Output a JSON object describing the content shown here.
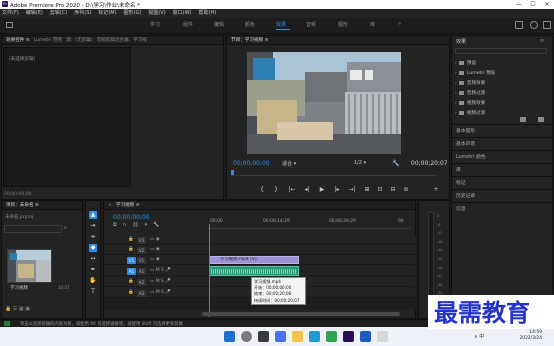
{
  "window": {
    "title": "Adobe Premiere Pro 2020 - D:\\学习\\作业\\未命名 *",
    "app_icon": "Pr",
    "controls": [
      "—",
      "☐",
      "✕"
    ]
  },
  "menubar": {
    "items": [
      "文件(F)",
      "编辑(E)",
      "剪辑(C)",
      "序列(S)",
      "标记(M)",
      "图形(G)",
      "视图(V)",
      "窗口(W)",
      "帮助(H)"
    ]
  },
  "workspaces": {
    "tabs": [
      {
        "label": "学习",
        "active": false
      },
      {
        "label": "组件",
        "active": false
      },
      {
        "label": "编辑",
        "active": false
      },
      {
        "label": "颜色",
        "active": false
      },
      {
        "label": "效果",
        "active": true
      },
      {
        "label": "音频",
        "active": false
      },
      {
        "label": "图形",
        "active": false
      },
      {
        "label": "库",
        "active": false
      }
    ],
    "more_icon": "double-chevron-icon"
  },
  "effect_controls": {
    "tabs": [
      "效果控件 ≡",
      "Lumetri 范围",
      "源：(无剪辑)",
      "音频剪辑混合器：学习视"
    ],
    "empty_text": "（未选择剪辑）",
    "timecode": "00;00;00;00"
  },
  "program_monitor": {
    "tab": "节目：学习视频 ≡",
    "timecode_current": "00;00;00;00",
    "timecode_duration": "00;00;20;07",
    "fit_label": "适合",
    "resolution_label": "1/2",
    "transport": [
      "{",
      "}",
      "|←",
      "◂|",
      "▶",
      "|▸",
      "→|",
      "⊞",
      "⊡",
      "⊟",
      "⊘",
      "+"
    ]
  },
  "effects_panel": {
    "title": "效果",
    "search_placeholder": "",
    "folders": [
      "预设",
      "Lumetri 预设",
      "音频效果",
      "音频过渡",
      "视频效果",
      "视频过渡"
    ],
    "sections": [
      "基本图形",
      "基本声音",
      "Lumetri 颜色",
      "库",
      "标记",
      "历史记录",
      "信息"
    ]
  },
  "project": {
    "tab": "项目：未命名 ≡",
    "project_file": "未命名.prproj",
    "clip_name": "学习视频",
    "clip_duration": "20:07"
  },
  "timeline": {
    "tab": "学习视频 ≡",
    "timecode": "00;00;00;00",
    "ruler_labels": [
      "00;00",
      "00;00;14;29",
      "00;00;29;29",
      "00"
    ],
    "tracks": [
      "V3",
      "V2",
      "V1",
      "A1",
      "A2",
      "A3"
    ],
    "video_clip_label": "学习视频.mp4 [V]",
    "tooltip": {
      "name": "学习视频.mp4",
      "start": "开始：00;00;00;00",
      "end": "结束：00;00;20;06",
      "duration": "持续时间：00;00;20;07"
    }
  },
  "audio_meter": {
    "scale": [
      "0",
      "-6",
      "-12",
      "-18",
      "-24",
      "-30",
      "-36",
      "-42",
      "-48",
      "-54",
      "dB"
    ],
    "solo_labels": [
      "S",
      "S"
    ]
  },
  "statusbar": {
    "message": "单击以选择剪辑的内容为新，或使用 Alt 可选择链接项，或使用 Shift 可选择更多剪辑"
  },
  "taskbar": {
    "sys": "∧ 中",
    "time": "14:59",
    "date": "2022/3/24"
  },
  "watermark": "最需教育",
  "colors": {
    "accent": "#2d8ceb",
    "clip_video": "#9d94d6",
    "clip_audio": "#2b9a7a"
  }
}
